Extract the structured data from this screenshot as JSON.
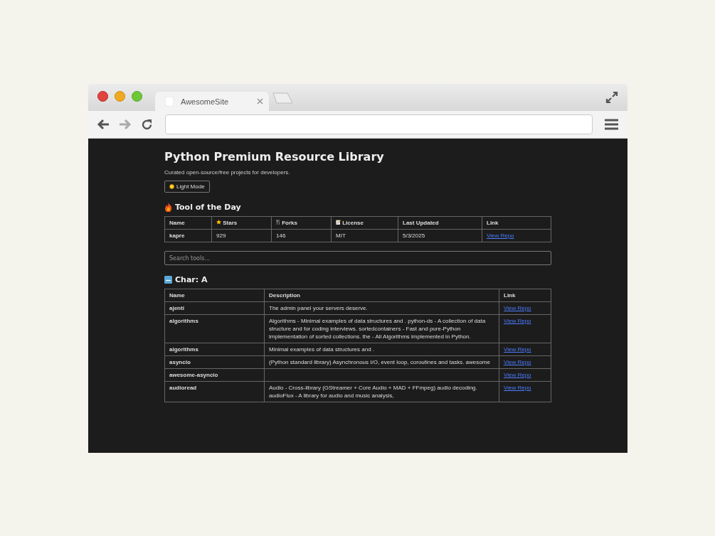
{
  "browser": {
    "tab_title": "AwesomeSite"
  },
  "page": {
    "title": "Python Premium Resource Library",
    "subtitle": "Curated open-source/free projects for developers.",
    "theme_button": "Light Mode",
    "tool_of_day": {
      "heading": "Tool of the Day",
      "columns": [
        "Name",
        "Stars",
        "Forks",
        "License",
        "Last Updated",
        "Link"
      ],
      "row": {
        "name": "kapre",
        "stars": "929",
        "forks": "146",
        "license": "MIT",
        "updated": "5/3/2025",
        "link": "View Repo"
      }
    },
    "search": {
      "placeholder": "Search tools..."
    },
    "section": {
      "heading": "Char: A",
      "columns": [
        "Name",
        "Description",
        "Link"
      ],
      "rows": [
        {
          "name": "ajenti",
          "description": "The admin panel your servers deserve.",
          "link": "View Repo"
        },
        {
          "name": "algorithms",
          "description": "Algorithms - Minimal examples of data structures and . python-ds - A collection of data structure and for coding interviews. sortedcontainers - Fast and pure-Python implementation of sorted collections. the - All Algorithms implemented in Python.",
          "link": "View Repo"
        },
        {
          "name": "algorithms",
          "description": "Minimal examples of data structures and .",
          "link": "View Repo"
        },
        {
          "name": "asyncio",
          "description": "(Python standard library) Asynchronous I/O, event loop, coroutines and tasks. awesome",
          "link": "View Repo"
        },
        {
          "name": "awesome-asyncio",
          "description": "",
          "link": "View Repo"
        },
        {
          "name": "audioread",
          "description": "Audio - Cross-library (GStreamer + Core Audio + MAD + FFmpeg) audio decoding. audioFlux - A library for audio and music analysis,",
          "link": "View Repo"
        }
      ]
    }
  }
}
